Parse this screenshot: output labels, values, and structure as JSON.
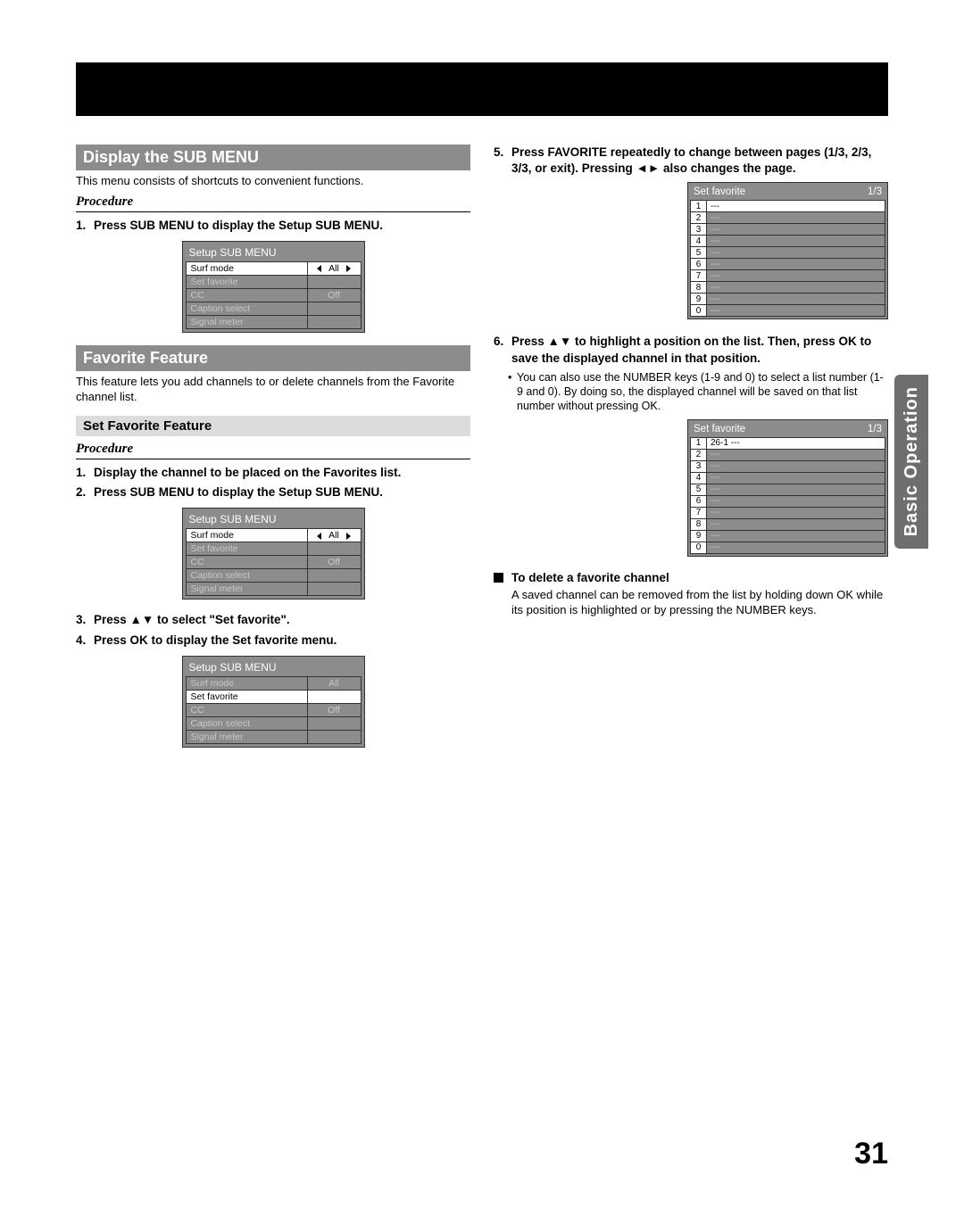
{
  "page": {
    "number": "31",
    "side_tab": "Basic Operation"
  },
  "left": {
    "h1": "Display the SUB MENU",
    "intro1": "This menu consists of shortcuts to convenient functions.",
    "proc_label": "Procedure",
    "steps1": [
      "Press SUB MENU to display the Setup SUB MENU."
    ],
    "osd1": {
      "title": "Setup SUB MENU",
      "rows": [
        {
          "label": "Surf mode",
          "value": "All",
          "hl_label": true,
          "arrows": true
        },
        {
          "label": "Set favorite",
          "value": ""
        },
        {
          "label": "CC",
          "value": "Off"
        },
        {
          "label": "Caption select",
          "value": ""
        },
        {
          "label": "Signal meter",
          "value": ""
        }
      ]
    },
    "h2": "Favorite Feature",
    "intro2": "This feature lets you add channels to or delete channels from the Favorite channel list.",
    "h3": "Set Favorite Feature",
    "proc_label2": "Procedure",
    "steps2": [
      "Display the channel to be placed on the Favorites list.",
      "Press SUB MENU to display the Setup SUB MENU."
    ],
    "osd2": {
      "title": "Setup SUB MENU",
      "rows": [
        {
          "label": "Surf mode",
          "value": "All",
          "hl_label": true,
          "arrows": true
        },
        {
          "label": "Set favorite",
          "value": ""
        },
        {
          "label": "CC",
          "value": "Off"
        },
        {
          "label": "Caption select",
          "value": ""
        },
        {
          "label": "Signal meter",
          "value": ""
        }
      ]
    },
    "step3": "Press ▲▼ to select \"Set favorite\".",
    "step4": "Press OK to display the Set favorite menu.",
    "osd3": {
      "title": "Setup SUB MENU",
      "rows": [
        {
          "label": "Surf mode",
          "value": "All"
        },
        {
          "label": "Set favorite",
          "value": "",
          "hl_label": true
        },
        {
          "label": "CC",
          "value": "Off"
        },
        {
          "label": "Caption select",
          "value": ""
        },
        {
          "label": "Signal meter",
          "value": ""
        }
      ]
    }
  },
  "right": {
    "step5": "Press FAVORITE repeatedly to change between pages (1/3, 2/3, 3/3, or exit). Pressing ◄► also changes the page.",
    "fav1": {
      "title": "Set favorite",
      "page": "1/3",
      "rows": [
        {
          "num": "1",
          "slot": "---",
          "hl": true
        },
        {
          "num": "2",
          "slot": "---"
        },
        {
          "num": "3",
          "slot": "---"
        },
        {
          "num": "4",
          "slot": "---"
        },
        {
          "num": "5",
          "slot": "---"
        },
        {
          "num": "6",
          "slot": "---"
        },
        {
          "num": "7",
          "slot": "---"
        },
        {
          "num": "8",
          "slot": "---"
        },
        {
          "num": "9",
          "slot": "---"
        },
        {
          "num": "0",
          "slot": "---"
        }
      ]
    },
    "step6": "Press ▲▼ to highlight a position on the list. Then, press OK to save the displayed channel in that position.",
    "step6_note": "You can also use the NUMBER keys (1-9 and 0) to select a list number (1-9 and 0). By doing so, the displayed channel will be saved on that list number without pressing OK.",
    "fav2": {
      "title": "Set favorite",
      "page": "1/3",
      "rows": [
        {
          "num": "1",
          "slot": "26-1    ---",
          "hl": true
        },
        {
          "num": "2",
          "slot": "---"
        },
        {
          "num": "3",
          "slot": "---"
        },
        {
          "num": "4",
          "slot": "---"
        },
        {
          "num": "5",
          "slot": "---"
        },
        {
          "num": "6",
          "slot": "---"
        },
        {
          "num": "7",
          "slot": "---"
        },
        {
          "num": "8",
          "slot": "---"
        },
        {
          "num": "9",
          "slot": "---"
        },
        {
          "num": "0",
          "slot": "---"
        }
      ]
    },
    "delete_h": "To delete a favorite channel",
    "delete_body": "A saved channel can be removed from the list by holding down OK while its position is highlighted or by pressing the NUMBER keys."
  }
}
